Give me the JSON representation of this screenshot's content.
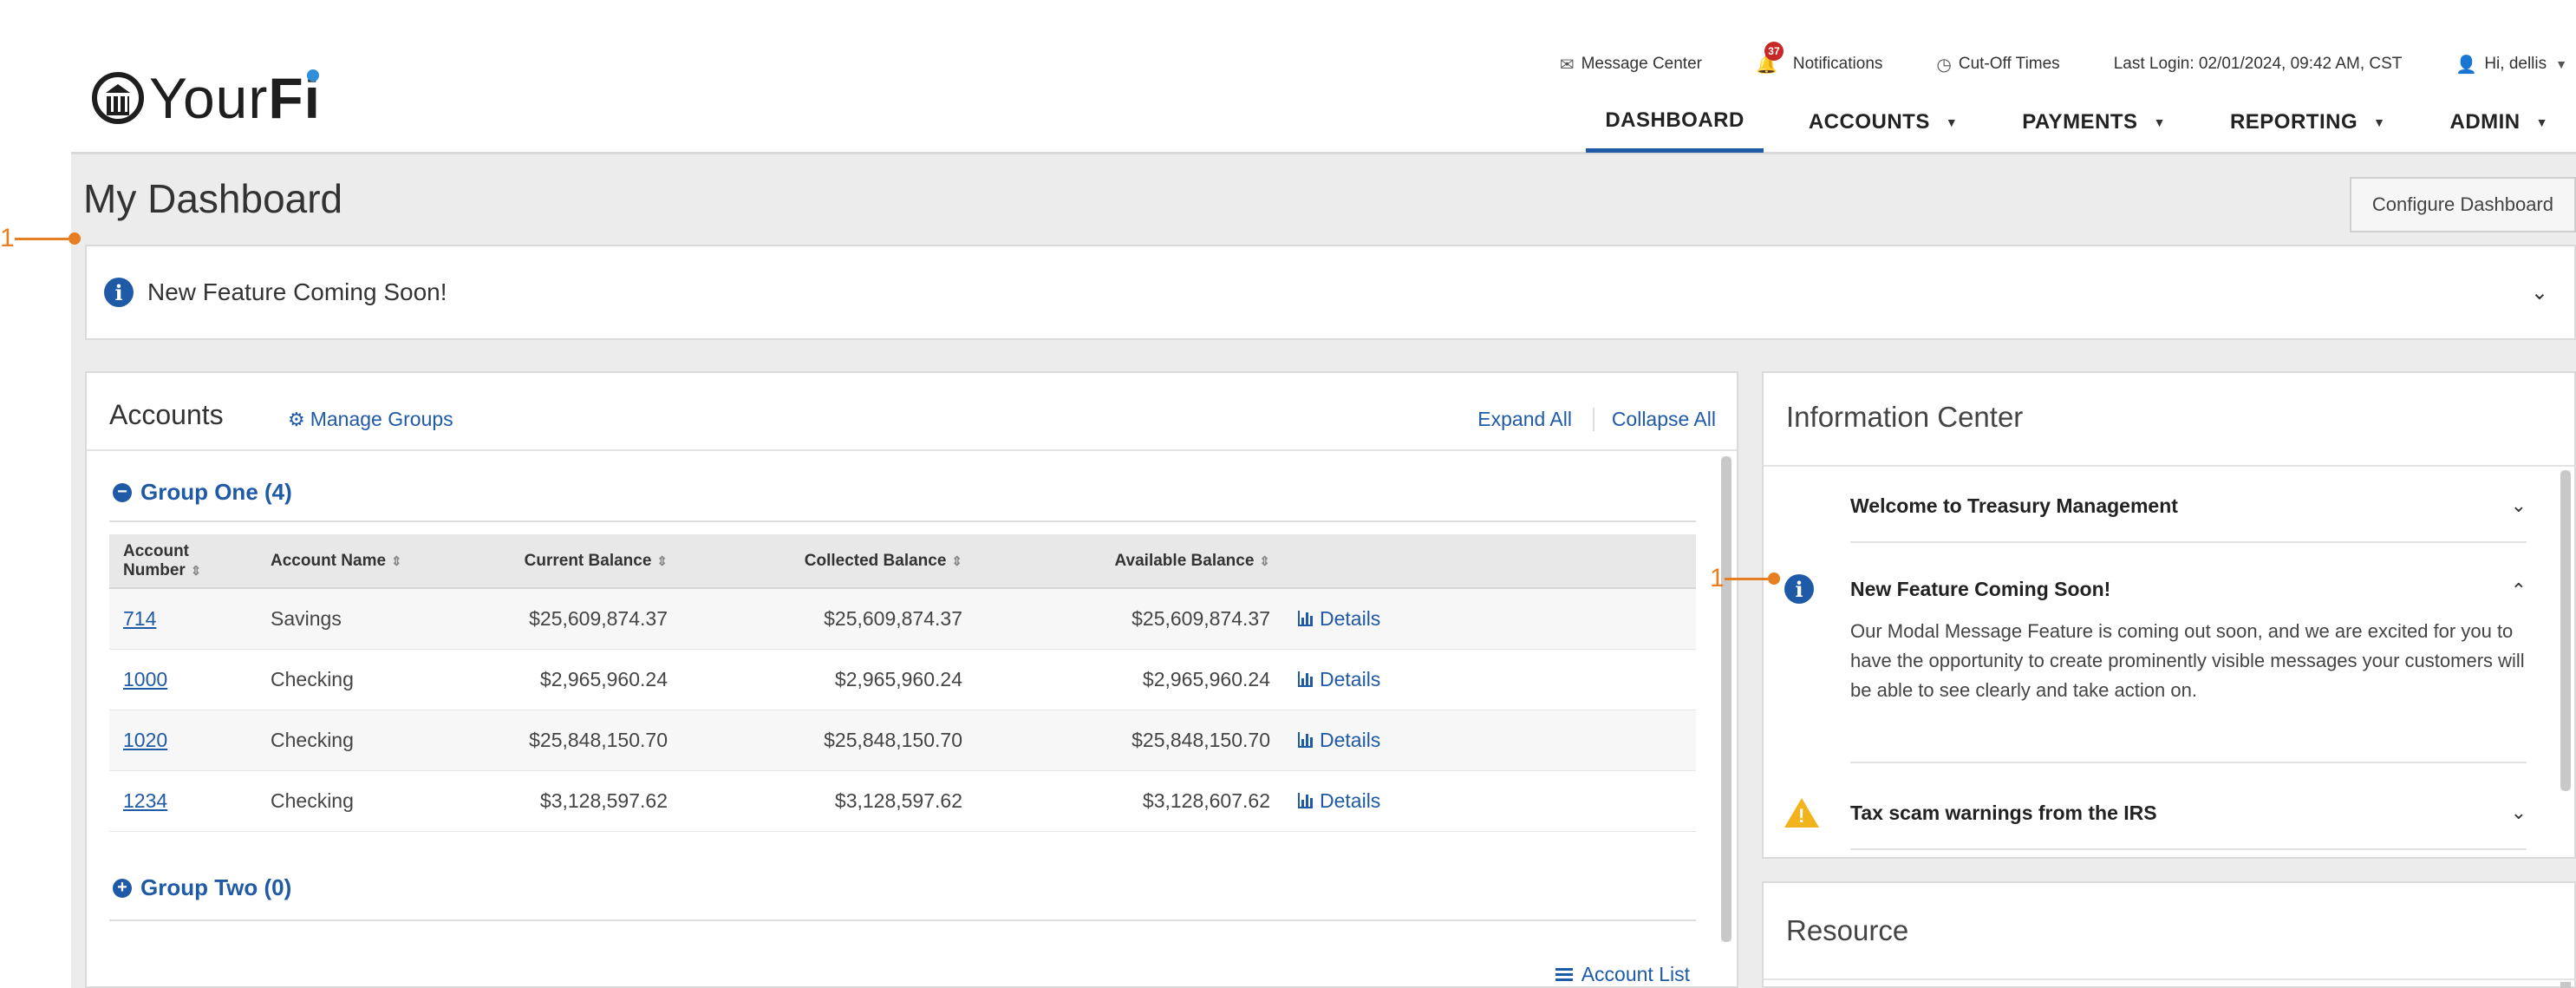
{
  "brand": {
    "name_light": "Your",
    "name_bold": "Fi"
  },
  "utility": {
    "message_center": "Message Center",
    "notifications": "Notifications",
    "notification_count": "37",
    "cutoff_times": "Cut-Off Times",
    "last_login": "Last Login: 02/01/2024, 09:42 AM, CST",
    "greeting": "Hi, dellis"
  },
  "nav": [
    {
      "label": "DASHBOARD",
      "active": true
    },
    {
      "label": "ACCOUNTS",
      "active": false
    },
    {
      "label": "PAYMENTS",
      "active": false
    },
    {
      "label": "REPORTING",
      "active": false
    },
    {
      "label": "ADMIN",
      "active": false
    }
  ],
  "page": {
    "title": "My Dashboard",
    "configure_button": "Configure Dashboard"
  },
  "notice": {
    "text": "New Feature Coming Soon!"
  },
  "callouts": {
    "first": "1",
    "second": "1"
  },
  "accounts": {
    "title": "Accounts",
    "manage_groups": "Manage Groups",
    "expand_all": "Expand All",
    "collapse_all": "Collapse All",
    "group_one": "Group One (4)",
    "group_two": "Group Two (0)",
    "columns": [
      "Account Number",
      "Account Name",
      "Current Balance",
      "Collected Balance",
      "Available Balance"
    ],
    "details_label": "Details",
    "rows": [
      {
        "number": "714",
        "name": "Savings",
        "current": "$25,609,874.37",
        "collected": "$25,609,874.37",
        "available": "$25,609,874.37"
      },
      {
        "number": "1000",
        "name": "Checking",
        "current": "$2,965,960.24",
        "collected": "$2,965,960.24",
        "available": "$2,965,960.24"
      },
      {
        "number": "1020",
        "name": "Checking",
        "current": "$25,848,150.70",
        "collected": "$25,848,150.70",
        "available": "$25,848,150.70"
      },
      {
        "number": "1234",
        "name": "Checking",
        "current": "$3,128,597.62",
        "collected": "$3,128,597.62",
        "available": "$3,128,607.62"
      }
    ],
    "account_list": "Account List"
  },
  "info_center": {
    "title": "Information Center",
    "items": [
      {
        "title": "Welcome to Treasury Management",
        "icon": "none",
        "expanded": false
      },
      {
        "title": "New Feature Coming Soon!",
        "icon": "info-icon",
        "expanded": true,
        "body": "Our Modal Message Feature is coming out soon, and we are excited for you to have the opportunity to create prominently visible messages your customers will be able to see clearly and take action on."
      },
      {
        "title": "Tax scam warnings from the IRS",
        "icon": "warning-icon",
        "expanded": false
      }
    ]
  },
  "resource": {
    "title": "Resource"
  },
  "colors": {
    "accent": "#1f5aa6",
    "callout": "#e87e22",
    "warning": "#f2b41c",
    "badge": "#c62828"
  }
}
